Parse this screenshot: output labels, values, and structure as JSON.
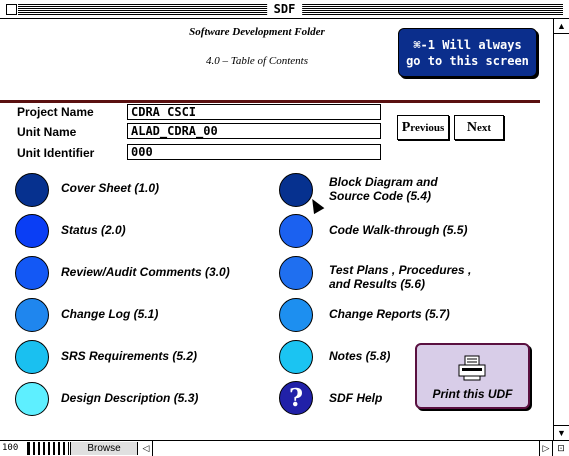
{
  "window": {
    "title": "SDF"
  },
  "header": {
    "folder_title": "Software Development Folder",
    "subtitle": "4.0 – Table of Contents",
    "shortcut_line1": "⌘-1 Will always",
    "shortcut_line2": "go to this screen"
  },
  "form": {
    "project_name_label": "Project Name",
    "project_name_value": "CDRA CSCI",
    "unit_name_label": "Unit Name",
    "unit_name_value": "ALAD_CDRA_00",
    "unit_identifier_label": "Unit Identifier",
    "unit_identifier_value": "000"
  },
  "nav": {
    "previous_cap": "P",
    "previous_rest": "revious",
    "next_cap": "N",
    "next_rest": "ext"
  },
  "toc_left": [
    {
      "label": "Cover Sheet (1.0)",
      "color": "#06318f"
    },
    {
      "label": "Status (2.0)",
      "color": "#0a3ef5"
    },
    {
      "label": "Review/Audit Comments (3.0)",
      "color": "#1358f5"
    },
    {
      "label": "Change Log (5.1)",
      "color": "#1f86ee"
    },
    {
      "label": "SRS Requirements (5.2)",
      "color": "#1ac0f0"
    },
    {
      "label": "Design Description (5.3)",
      "color": "#5eefff"
    }
  ],
  "toc_right": [
    {
      "label": "Block Diagram  and\nSource Code (5.4)",
      "color": "#06318f"
    },
    {
      "label": "Code Walk-through (5.5)",
      "color": "#1b61f0"
    },
    {
      "label": "Test Plans , Procedures ,\nand Results (5.6)",
      "color": "#1f6ff0"
    },
    {
      "label": "Change Reports (5.7)",
      "color": "#1d8ff0"
    },
    {
      "label": "Notes (5.8)",
      "color": "#1bc4f2"
    },
    {
      "label": "SDF Help",
      "color": "#2121a8"
    }
  ],
  "help_icon_glyph": "?",
  "print_button": {
    "label": "Print this UDF"
  },
  "status": {
    "zoom": "100",
    "mode": "Browse"
  }
}
